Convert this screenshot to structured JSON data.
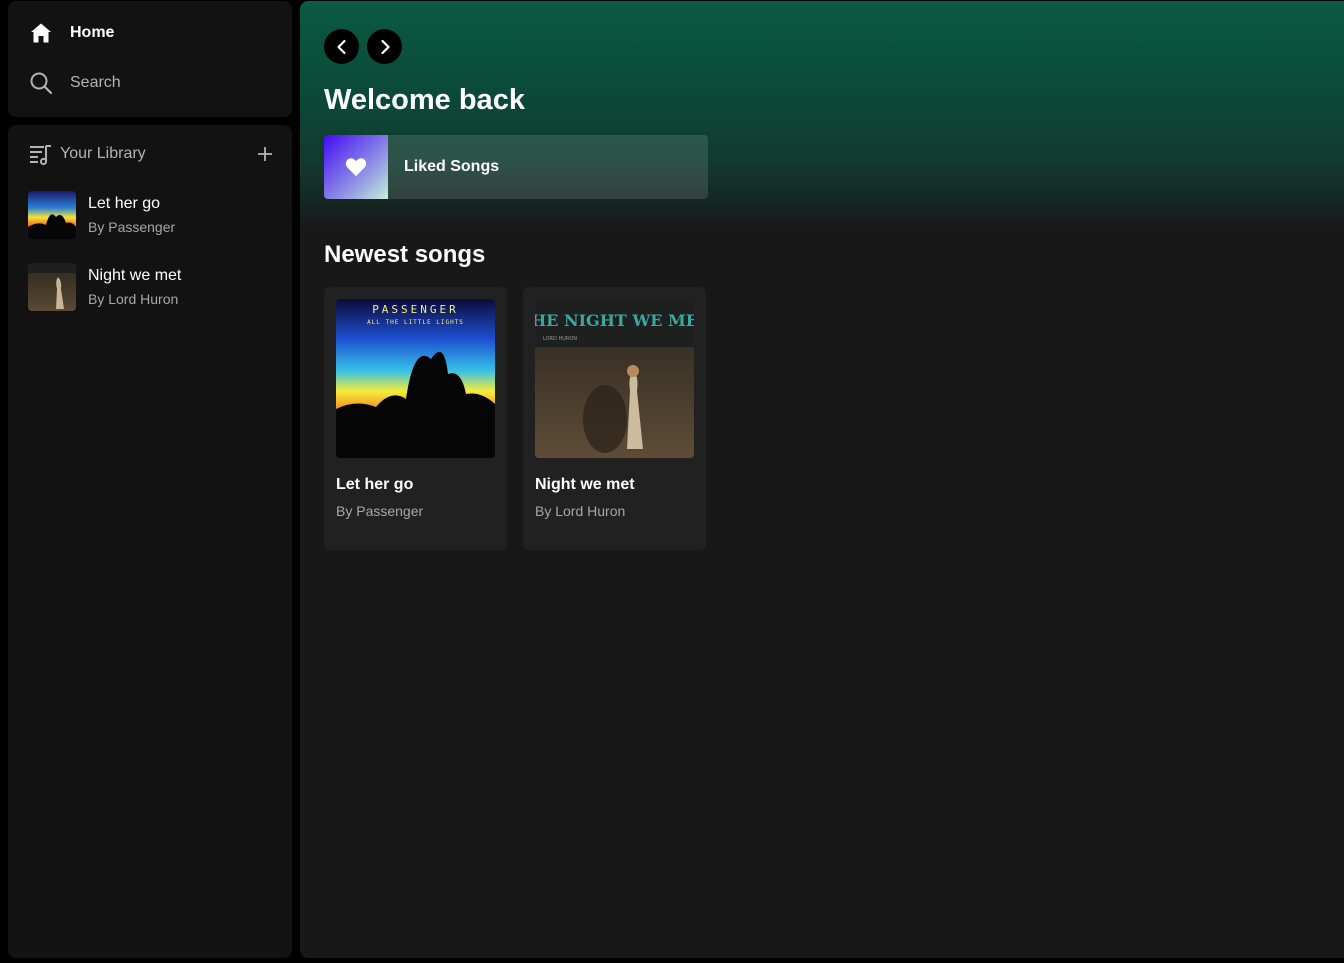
{
  "nav": {
    "home_label": "Home",
    "search_label": "Search",
    "home_icon": "home-icon",
    "search_icon": "search-icon"
  },
  "library": {
    "title": "Your Library",
    "items": [
      {
        "title": "Let her go",
        "artist": "By Passenger"
      },
      {
        "title": "Night we met",
        "artist": "By Lord Huron"
      }
    ]
  },
  "main": {
    "welcome": "Welcome back",
    "liked_songs_label": "Liked Songs",
    "newest_heading": "Newest songs",
    "cards": [
      {
        "title": "Let her go",
        "artist": "By Passenger",
        "art_line1": "PASSENGER",
        "art_line2": "ALL THE LITTLE LIGHTS"
      },
      {
        "title": "Night we met",
        "artist": "By Lord Huron",
        "art_line1": "THE NIGHT WE MET",
        "art_line2": "LORD HURON"
      }
    ]
  },
  "colors": {
    "accent_green": "#0a5a44",
    "panel_bg": "#121212",
    "card_bg": "#212121",
    "muted_text": "#b3b3b3"
  }
}
